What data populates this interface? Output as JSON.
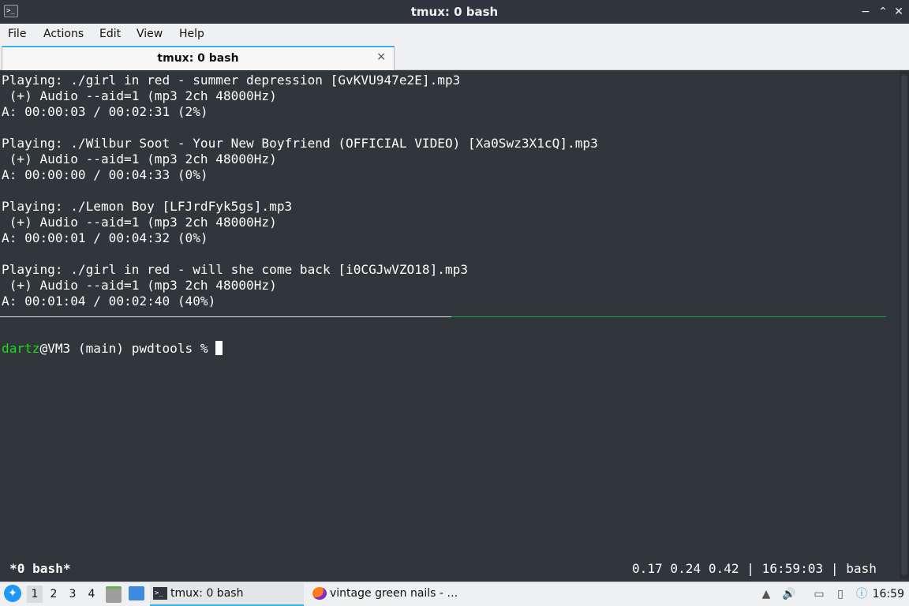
{
  "window": {
    "title": "tmux: 0 bash",
    "icon_glyph": ">_",
    "buttons": {
      "minimize": "−",
      "maximize": "⌃",
      "close": "✕"
    }
  },
  "menu": [
    "File",
    "Actions",
    "Edit",
    "View",
    "Help"
  ],
  "tabs": [
    {
      "label": "tmux: 0 bash",
      "close": "×"
    }
  ],
  "terminal": {
    "lines": [
      "Playing: ./girl in red - summer depression [GvKVU947e2E].mp3",
      " (+) Audio --aid=1 (mp3 2ch 48000Hz)",
      "A: 00:00:03 / 00:02:31 (2%)",
      "",
      "Playing: ./Wilbur Soot - Your New Boyfriend (OFFICIAL VIDEO) [Xa0Swz3X1cQ].mp3",
      " (+) Audio --aid=1 (mp3 2ch 48000Hz)",
      "A: 00:00:00 / 00:04:33 (0%)",
      "",
      "Playing: ./Lemon Boy [LFJrdFyk5gs].mp3",
      " (+) Audio --aid=1 (mp3 2ch 48000Hz)",
      "A: 00:00:01 / 00:04:32 (0%)",
      "",
      "Playing: ./girl in red - will she come back [i0CGJwVZO18].mp3",
      " (+) Audio --aid=1 (mp3 2ch 48000Hz)",
      "A: 00:01:04 / 00:02:40 (40%)"
    ],
    "prompt": {
      "user": "dartz",
      "rest": "@VM3 (main) pwdtools % "
    },
    "status_left": "*0 bash*",
    "status_right": "0.17 0.24 0.42 | 16:59:03 | bash",
    "colors": {
      "background": "#31363b",
      "text": "#fcfcfc",
      "user": "#1cdc1c",
      "active_pane_border": "#18a33b"
    }
  },
  "taskbar": {
    "start_icon": "start-menu-icon",
    "workspaces": [
      "1",
      "2",
      "3",
      "4"
    ],
    "active_workspace": "1",
    "tasks": [
      {
        "label": "tmux: 0 bash",
        "icon": "terminal-icon",
        "active": true
      },
      {
        "label": "vintage green nails - …",
        "icon": "firefox-icon",
        "active": false
      }
    ],
    "tray": [
      "upload-icon",
      "volume-icon",
      "network-icon",
      "clipboard-icon",
      "notification-icon"
    ],
    "clock": "16:59"
  }
}
